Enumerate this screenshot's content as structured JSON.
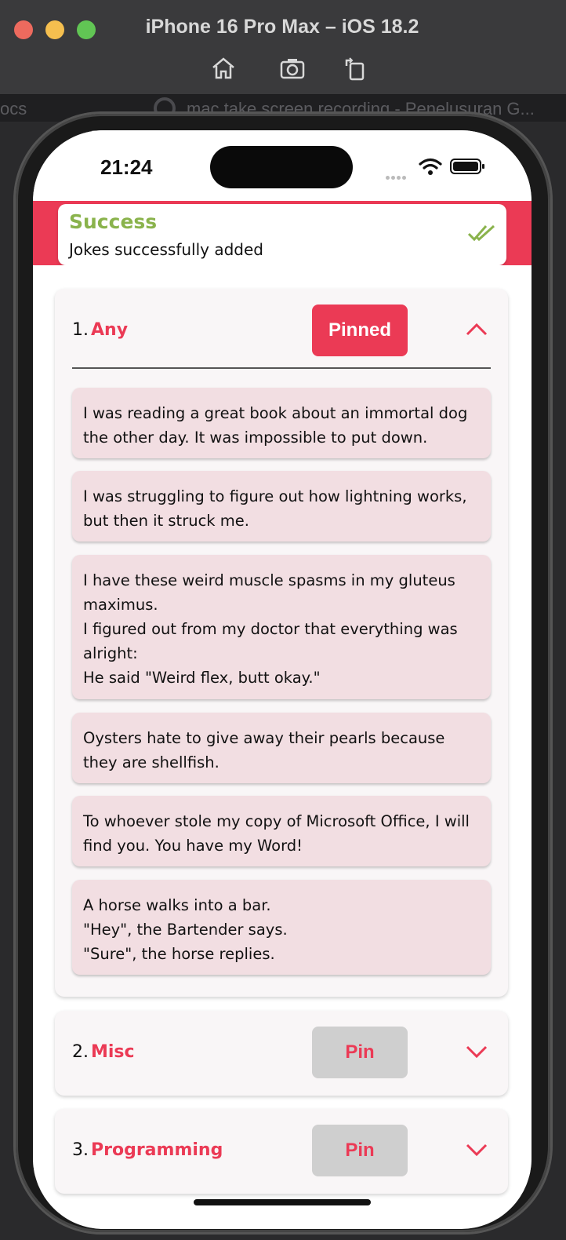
{
  "simulator": {
    "title": "iPhone 16 Pro Max – iOS 18.2",
    "toolbar": [
      "home-icon",
      "screenshot-icon",
      "rotate-icon"
    ]
  },
  "background_browser": {
    "left_tab_text": "ocs",
    "right_tab_text": "mac take screen recording - Penelusuran G..."
  },
  "status_bar": {
    "time": "21:24"
  },
  "toast": {
    "title": "Success",
    "message": "Jokes successfully added",
    "accent_color": "#eb3a55",
    "title_color": "#8ab34c"
  },
  "categories": [
    {
      "number": "1.",
      "name": "Any",
      "pin_label": "Pinned",
      "pinned": true,
      "expanded": true,
      "jokes": [
        "I was reading a great book about an immortal dog the other day. It was impossible to put down.",
        "I was struggling to figure out how lightning works, but then it struck me.",
        "I have these weird muscle spasms in my gluteus maximus.\nI figured out from my doctor that everything was alright:\nHe said \"Weird flex, butt okay.\"",
        "Oysters hate to give away their pearls because they are shellfish.",
        "To whoever stole my copy of Microsoft Office, I will find you. You have my Word!",
        "A horse walks into a bar.\n\"Hey\", the Bartender says.\n\"Sure\", the horse replies."
      ]
    },
    {
      "number": "2.",
      "name": "Misc",
      "pin_label": "Pin",
      "pinned": false,
      "expanded": false
    },
    {
      "number": "3.",
      "name": "Programming",
      "pin_label": "Pin",
      "pinned": false,
      "expanded": false
    }
  ]
}
